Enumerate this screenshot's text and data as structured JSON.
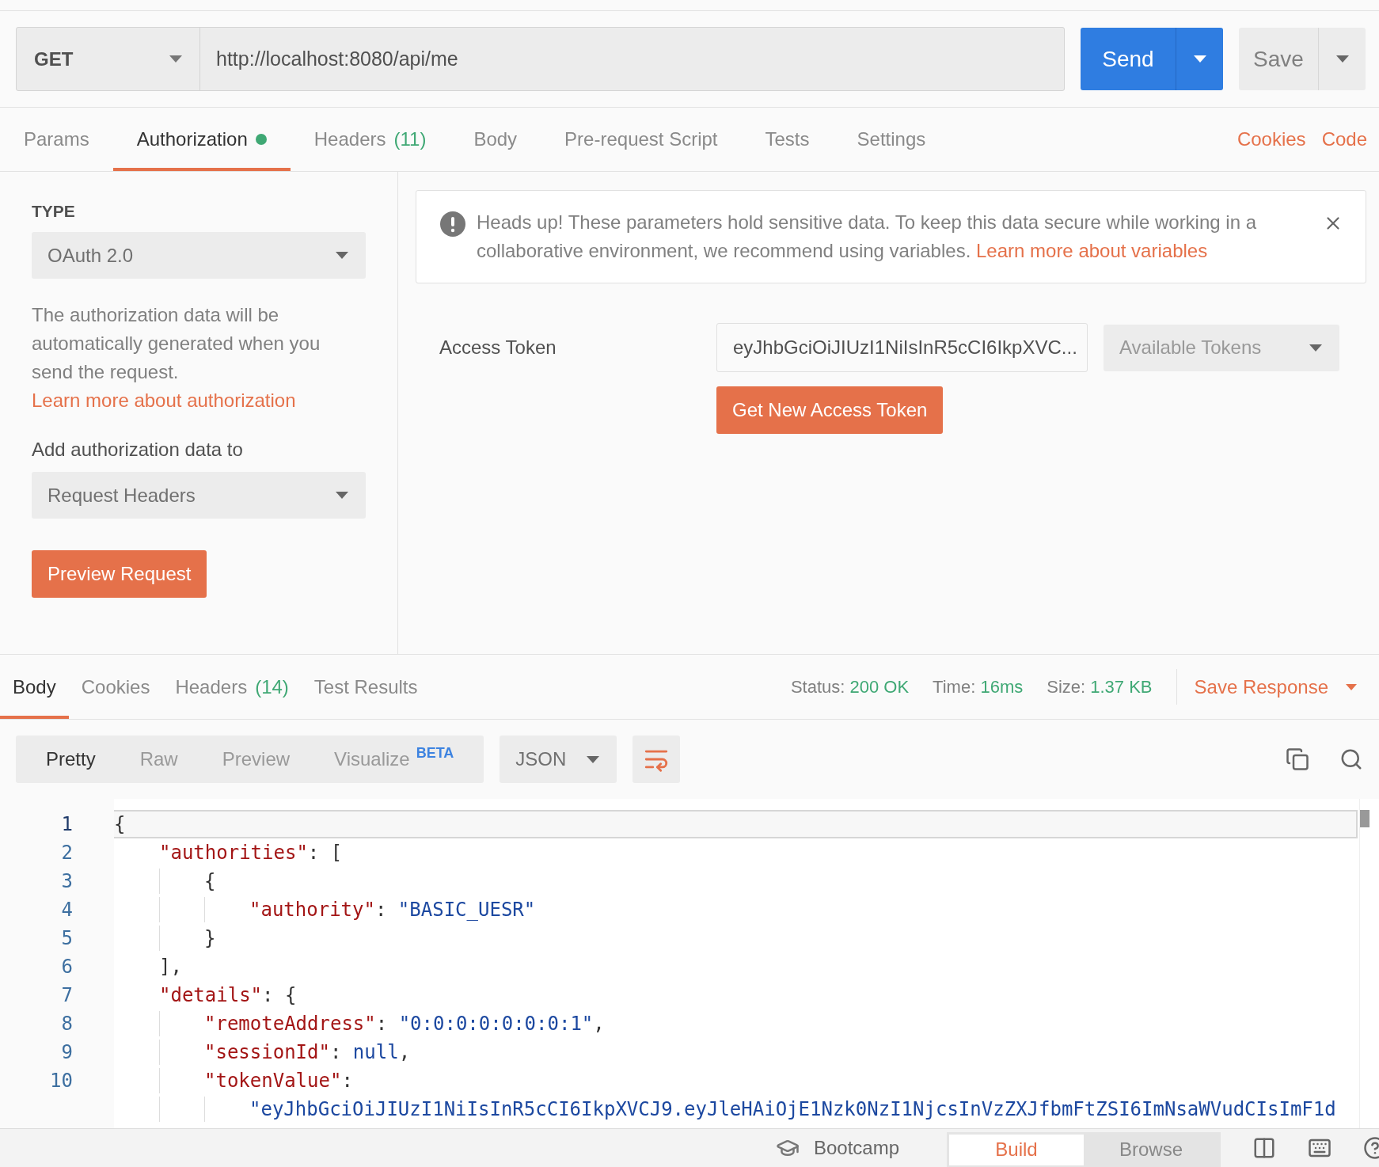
{
  "request": {
    "method": "GET",
    "url": "http://localhost:8080/api/me",
    "send_label": "Send",
    "save_label": "Save"
  },
  "request_tabs": [
    {
      "label": "Params",
      "selected": false,
      "dot": false
    },
    {
      "label": "Authorization",
      "selected": true,
      "dot": true
    },
    {
      "label": "Headers",
      "count": "(11)",
      "selected": false,
      "dot": false
    },
    {
      "label": "Body",
      "selected": false,
      "dot": false
    },
    {
      "label": "Pre-request Script",
      "selected": false,
      "dot": false
    },
    {
      "label": "Tests",
      "selected": false,
      "dot": false
    },
    {
      "label": "Settings",
      "selected": false,
      "dot": false
    }
  ],
  "request_links": [
    "Cookies",
    "Code"
  ],
  "auth": {
    "type_label": "TYPE",
    "type_value": "OAuth 2.0",
    "description": "The authorization data will be automatically generated when you send the request.",
    "description_link": "Learn more about authorization",
    "add_to_label": "Add authorization data to",
    "add_to_value": "Request Headers",
    "preview_button": "Preview Request"
  },
  "notice": {
    "text": "Heads up! These parameters hold sensitive data. To keep this data secure while working in a collaborative environment, we recommend using variables.",
    "link": "Learn more about variables"
  },
  "access_token": {
    "label": "Access Token",
    "value": "eyJhbGciOiJIUzI1NiIsInR5cCI6IkpXVC...",
    "tokens_placeholder": "Available Tokens",
    "get_button": "Get New Access Token"
  },
  "response_tabs": [
    {
      "label": "Body",
      "selected": true
    },
    {
      "label": "Cookies",
      "selected": false
    },
    {
      "label": "Headers",
      "count": "(14)",
      "selected": false
    },
    {
      "label": "Test Results",
      "selected": false
    }
  ],
  "response_meta": [
    {
      "label": "Status:",
      "value": "200 OK"
    },
    {
      "label": "Time:",
      "value": "16ms"
    },
    {
      "label": "Size:",
      "value": "1.37 KB"
    }
  ],
  "save_response": "Save Response",
  "view_modes": [
    {
      "label": "Pretty",
      "selected": true
    },
    {
      "label": "Raw",
      "selected": false
    },
    {
      "label": "Preview",
      "selected": false
    },
    {
      "label": "Visualize",
      "badge": "BETA",
      "selected": false
    }
  ],
  "format": "JSON",
  "code_lines": [
    {
      "number": "1",
      "current": true,
      "tokens": [
        {
          "kind": "punct",
          "text": "{"
        }
      ]
    },
    {
      "number": "2",
      "current": false,
      "tokens": [
        {
          "kind": "key",
          "text": "    \"authorities\""
        },
        {
          "kind": "punct",
          "text": ": ["
        }
      ]
    },
    {
      "number": "3",
      "current": false,
      "tokens": [
        {
          "kind": "punct",
          "text": "        {"
        }
      ]
    },
    {
      "number": "4",
      "current": false,
      "tokens": [
        {
          "kind": "key",
          "text": "            \"authority\""
        },
        {
          "kind": "punct",
          "text": ": "
        },
        {
          "kind": "string",
          "text": "\"BASIC_UESR\""
        }
      ]
    },
    {
      "number": "5",
      "current": false,
      "tokens": [
        {
          "kind": "punct",
          "text": "        }"
        }
      ]
    },
    {
      "number": "6",
      "current": false,
      "tokens": [
        {
          "kind": "punct",
          "text": "    ],"
        }
      ]
    },
    {
      "number": "7",
      "current": false,
      "tokens": [
        {
          "kind": "key",
          "text": "    \"details\""
        },
        {
          "kind": "punct",
          "text": ": {"
        }
      ]
    },
    {
      "number": "8",
      "current": false,
      "tokens": [
        {
          "kind": "key",
          "text": "        \"remoteAddress\""
        },
        {
          "kind": "punct",
          "text": ": "
        },
        {
          "kind": "string",
          "text": "\"0:0:0:0:0:0:0:1\""
        },
        {
          "kind": "punct",
          "text": ","
        }
      ]
    },
    {
      "number": "9",
      "current": false,
      "tokens": [
        {
          "kind": "key",
          "text": "        \"sessionId\""
        },
        {
          "kind": "punct",
          "text": ": "
        },
        {
          "kind": "null",
          "text": "null"
        },
        {
          "kind": "punct",
          "text": ","
        }
      ]
    },
    {
      "number": "10",
      "current": false,
      "tokens": [
        {
          "kind": "key",
          "text": "        \"tokenValue\""
        },
        {
          "kind": "punct",
          "text": ":"
        }
      ]
    },
    {
      "current": false,
      "tokens": [
        {
          "kind": "string",
          "text": "            \"eyJhbGciOiJIUzI1NiIsInR5cCI6IkpXVCJ9.eyJleHAiOjE1Nzk0NzI1NjcsInVzZXJfbmFtZSI6ImNsaWVudCIsImF1d"
        }
      ]
    }
  ],
  "footer": {
    "bootcamp": "Bootcamp",
    "modes": [
      {
        "label": "Build",
        "selected": true
      },
      {
        "label": "Browse",
        "selected": false
      }
    ]
  }
}
